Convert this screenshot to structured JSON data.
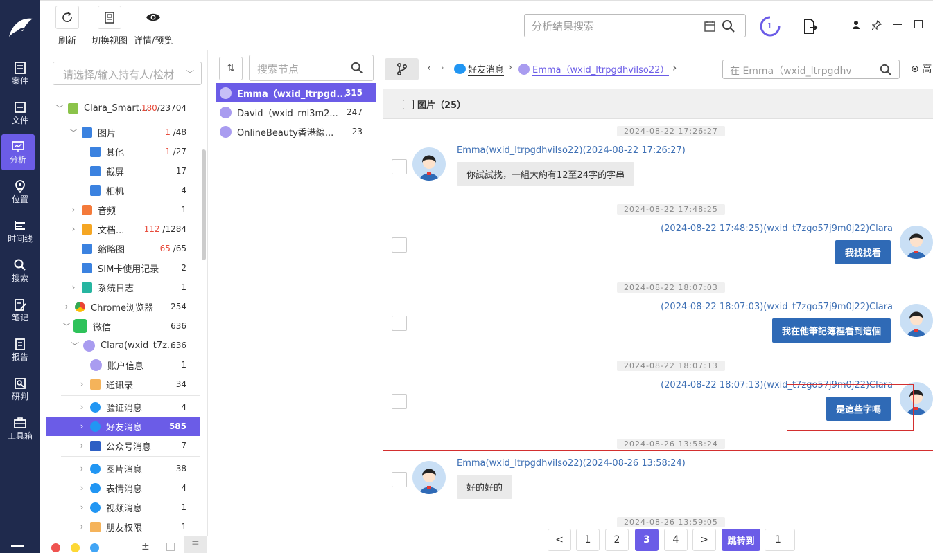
{
  "nav": [
    {
      "label": "案件",
      "icon": "case-icon"
    },
    {
      "label": "文件",
      "icon": "file-icon"
    },
    {
      "label": "分析",
      "icon": "analysis-icon"
    },
    {
      "label": "位置",
      "icon": "location-icon"
    },
    {
      "label": "时间线",
      "icon": "timeline-icon"
    },
    {
      "label": "搜索",
      "icon": "search-icon"
    },
    {
      "label": "笔记",
      "icon": "note-icon"
    },
    {
      "label": "报告",
      "icon": "report-icon"
    },
    {
      "label": "研判",
      "icon": "judge-icon"
    },
    {
      "label": "工具箱",
      "icon": "toolbox-icon"
    }
  ],
  "toolbar": {
    "refresh": "刷新",
    "switch_view": "切换视图",
    "detail_preview": "详情/预览",
    "search_placeholder": "分析结果搜索",
    "badge": "1"
  },
  "tree": {
    "owner_placeholder": "请选择/输入持有人/检材",
    "rows": [
      {
        "label": "Clara_Smart...",
        "count_red": "180",
        "count": "/23704"
      },
      {
        "label": "图片",
        "count_red": "1",
        "count": "/48"
      },
      {
        "label": "其他",
        "count_red": "1",
        "count": "/27"
      },
      {
        "label": "截屏",
        "count": "17"
      },
      {
        "label": "相机",
        "count": "4"
      },
      {
        "label": "音频",
        "count": "1"
      },
      {
        "label": "文档...",
        "count_red": "112",
        "count": "/1284"
      },
      {
        "label": "缩略图",
        "count_red": "65",
        "count": "/65"
      },
      {
        "label": "SIM卡使用记录",
        "count": "2"
      },
      {
        "label": "系统日志",
        "count": "1"
      },
      {
        "label": "Chrome浏览器",
        "count": "254"
      },
      {
        "label": "微信",
        "count": "636"
      },
      {
        "label": "Clara(wxid_t7z...",
        "count": "636"
      },
      {
        "label": "账户信息",
        "count": "1"
      },
      {
        "label": "通讯录",
        "count": "34"
      },
      {
        "label": "验证消息",
        "count": "4"
      },
      {
        "label": "好友消息",
        "count": "585"
      },
      {
        "label": "公众号消息",
        "count": "7"
      },
      {
        "label": "图片消息",
        "count": "38"
      },
      {
        "label": "表情消息",
        "count": "4"
      },
      {
        "label": "视频消息",
        "count": "1"
      },
      {
        "label": "朋友权限",
        "count": "1"
      }
    ]
  },
  "nodes": {
    "search_placeholder": "搜索节点",
    "items": [
      {
        "label": "Emma（wxid_ltrpgd...",
        "count": "315"
      },
      {
        "label": "David（wxid_rni3m2...",
        "count": "247"
      },
      {
        "label": "OnlineBeauty香港線...",
        "count": "23"
      }
    ]
  },
  "chat": {
    "crumb_friend": "好友消息",
    "crumb_contact": "Emma（wxid_ltrpgdhvilso22）",
    "search_placeholder": "在 Emma（wxid_ltrpgdhv",
    "right_cut": "高",
    "photos_label": "图片（25）",
    "messages": [
      {
        "time": "2024-08-22 17:26:27",
        "sender": "Emma(wxid_ltrpgdhvilso22)(2024-08-22 17:26:27)",
        "text": "你試試找，一組大約有12至24字的字串",
        "dir": "in"
      },
      {
        "time": "2024-08-22 17:48:25",
        "sender": "(2024-08-22 17:48:25)(wxid_t7zgo57j9m0j22)Clara",
        "text": "我找找看",
        "dir": "out"
      },
      {
        "time": "2024-08-22 18:07:03",
        "sender": "(2024-08-22 18:07:03)(wxid_t7zgo57j9m0j22)Clara",
        "text": "我在他筆記簿裡看到這個",
        "dir": "out"
      },
      {
        "time": "2024-08-22 18:07:13",
        "sender": "(2024-08-22 18:07:13)(wxid_t7zgo57j9m0j22)Clara",
        "text": "是這些字嗎",
        "dir": "out"
      },
      {
        "time": "2024-08-26 13:58:24",
        "sender": "Emma(wxid_ltrpgdhvilso22)(2024-08-26 13:58:24)",
        "text": "好的好的",
        "dir": "in"
      },
      {
        "time": "2024-08-26 13:59:05"
      }
    ]
  },
  "pagination": {
    "prev": "<",
    "pages": [
      "1",
      "2",
      "3",
      "4"
    ],
    "next": ">",
    "jump": "跳转到",
    "jump_value": "1"
  },
  "colors": {
    "accent": "#6b5ce7",
    "nav_bg": "#1f2a4d",
    "bubble_out": "#2f6ab6",
    "highlight": "#d32f2f"
  }
}
